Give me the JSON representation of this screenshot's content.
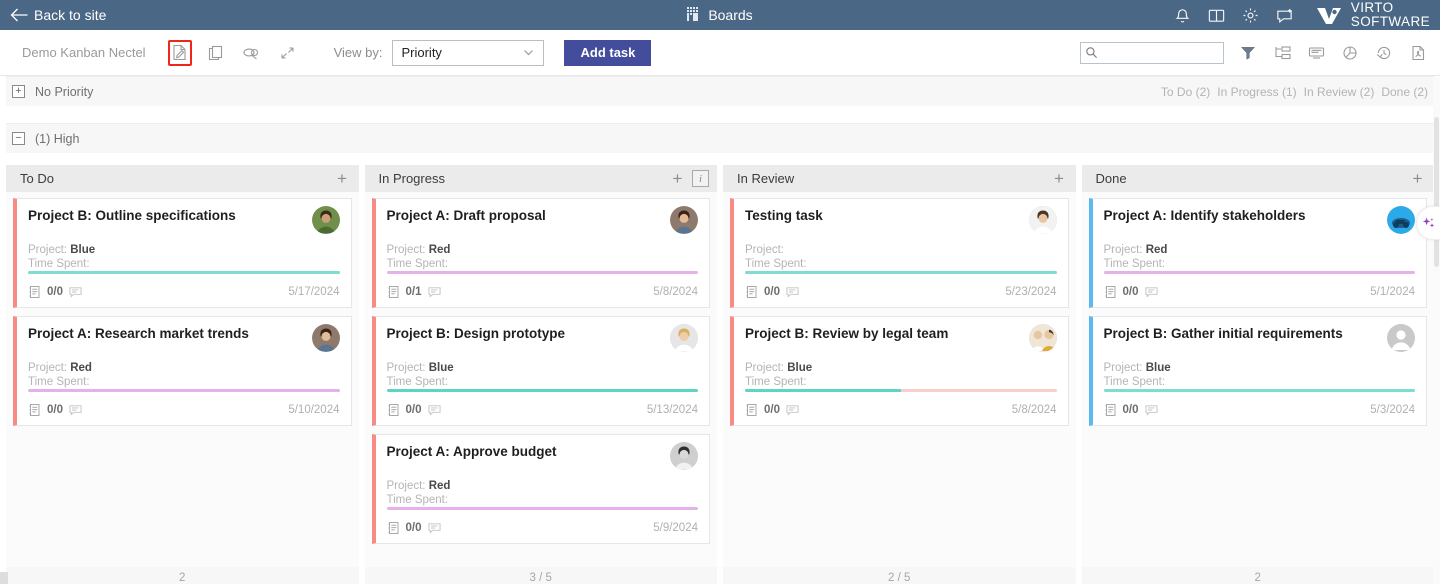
{
  "topbar": {
    "back_label": "Back to site",
    "back_icon": "arrow-left-icon",
    "center_title": "Boards",
    "center_icon": "boards-grid-icon",
    "icons": [
      "bell-icon",
      "book-icon",
      "gear-icon",
      "chat-plus-icon"
    ],
    "brand_line1": "VIRTO",
    "brand_line2": "SOFTWARE",
    "bg_color": "#4a6785"
  },
  "toolbar": {
    "board_name": "Demo Kanban Nectel",
    "icons": [
      "edit-document-icon",
      "copy-icon",
      "link-off-icon",
      "collapse-icon"
    ],
    "view_by_label": "View by:",
    "view_by_value": "Priority",
    "view_by_options": [
      "Priority"
    ],
    "add_task_label": "Add task",
    "add_task_color": "#434d9b",
    "highlight_color": "#f0261a",
    "search_placeholder": "",
    "search_value": "",
    "right_icons": [
      "filter-icon",
      "swimlane-icon",
      "card-settings-icon",
      "chart-icon",
      "history-icon",
      "export-pdf-icon"
    ]
  },
  "groups": [
    {
      "id": "no-priority",
      "label": "No Priority",
      "collapsed": true,
      "expander": "+",
      "counts": [
        "To Do (2)",
        "In Progress (1)",
        "In Review (2)",
        "Done (2)"
      ]
    },
    {
      "id": "high",
      "label": "(1) High",
      "collapsed": false,
      "expander": "−",
      "counts": []
    }
  ],
  "columns": [
    {
      "title": "To Do",
      "has_info": false,
      "footer": "2",
      "cards": [
        {
          "title": "Project B: Outline specifications",
          "project_label": "Project:",
          "project_value": "Blue",
          "time_label": "Time Spent:",
          "time_value": "",
          "checklist": "0/0",
          "date": "5/17/2024",
          "accent": "#f98b85",
          "progress": [
            {
              "color": "#7fdcd0",
              "pct": 100
            }
          ],
          "avatar": "photo-outdoors-green"
        },
        {
          "title": "Project A: Research market trends",
          "project_label": "Project:",
          "project_value": "Red",
          "time_label": "Time Spent:",
          "time_value": "",
          "checklist": "0/0",
          "date": "5/10/2024",
          "accent": "#f98b85",
          "progress": [
            {
              "color": "#e4b2e8",
              "pct": 100
            }
          ],
          "avatar": "photo-woman-dark"
        }
      ]
    },
    {
      "title": "In Progress",
      "has_info": true,
      "footer": "3 / 5",
      "cards": [
        {
          "title": "Project A: Draft proposal",
          "project_label": "Project:",
          "project_value": "Red",
          "time_label": "Time Spent:",
          "time_value": "",
          "checklist": "0/1",
          "date": "5/8/2024",
          "accent": "#f98b85",
          "progress": [
            {
              "color": "#e4b2e8",
              "pct": 100
            }
          ],
          "avatar": "photo-woman-dark"
        },
        {
          "title": "Project B: Design prototype",
          "project_label": "Project:",
          "project_value": "Blue",
          "time_label": "Time Spent:",
          "time_value": "",
          "checklist": "0/0",
          "date": "5/13/2024",
          "accent": "#f98b85",
          "progress": [
            {
              "color": "#5fd3c4",
              "pct": 100
            }
          ],
          "avatar": "photo-woman-blonde"
        },
        {
          "title": "Project A: Approve budget",
          "project_label": "Project:",
          "project_value": "Red",
          "time_label": "Time Spent:",
          "time_value": "",
          "checklist": "0/0",
          "date": "5/9/2024",
          "accent": "#f98b85",
          "progress": [
            {
              "color": "#e4b2e8",
              "pct": 100
            }
          ],
          "avatar": "photo-woman-grey"
        }
      ]
    },
    {
      "title": "In Review",
      "has_info": false,
      "footer": "2 / 5",
      "cards": [
        {
          "title": "Testing task",
          "project_label": "Project:",
          "project_value": "",
          "time_label": "Time Spent:",
          "time_value": "",
          "checklist": "0/0",
          "date": "5/23/2024",
          "accent": "#f98b85",
          "progress": [
            {
              "color": "#7fdcd0",
              "pct": 100
            }
          ],
          "avatar": "photo-man-beard"
        },
        {
          "title": "Project B: Review by legal team",
          "project_label": "Project:",
          "project_value": "Blue",
          "time_label": "Time Spent:",
          "time_value": "",
          "checklist": "0/0",
          "date": "5/8/2024",
          "accent": "#f98b85",
          "progress": [
            {
              "color": "#5fd3c4",
              "pct": 50
            },
            {
              "color": "#f8cfcb",
              "pct": 50
            }
          ],
          "avatar": "photo-two-people"
        }
      ]
    },
    {
      "title": "Done",
      "has_info": false,
      "footer": "2",
      "cards": [
        {
          "title": "Project A: Identify stakeholders",
          "project_label": "Project:",
          "project_value": "Red",
          "time_label": "Time Spent:",
          "time_value": "",
          "checklist": "0/0",
          "date": "5/1/2024",
          "accent": "#5bb8f0",
          "progress": [
            {
              "color": "#e4b2e8",
              "pct": 100
            }
          ],
          "avatar": "photo-motorcycle-blue"
        },
        {
          "title": "Project B: Gather initial requirements",
          "project_label": "Project:",
          "project_value": "Blue",
          "time_label": "Time Spent:",
          "time_value": "",
          "checklist": "0/0",
          "date": "5/3/2024",
          "accent": "#5bb8f0",
          "progress": [
            {
              "color": "#7fdcd0",
              "pct": 100
            }
          ],
          "avatar": "default-person-icon"
        }
      ]
    }
  ],
  "ai_tab": {
    "icon": "sparkles-icon",
    "color": "#8e44c8"
  }
}
